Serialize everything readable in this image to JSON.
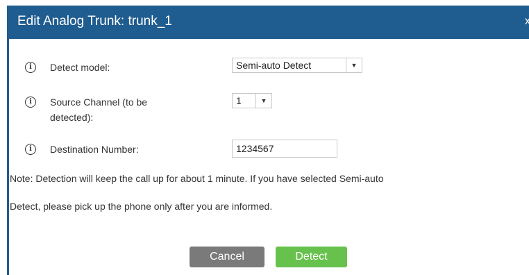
{
  "dialog": {
    "title": "Edit Analog Trunk: trunk_1",
    "close_label": "x"
  },
  "fields": {
    "detect_model": {
      "label": "Detect model:",
      "value": "Semi-auto Detect",
      "icon": "info-icon"
    },
    "source_channel": {
      "label_line1": "Source Channel (to be",
      "label_line2": "detected):",
      "value": "1",
      "icon": "info-icon"
    },
    "destination_number": {
      "label": "Destination Number:",
      "value": "1234567",
      "icon": "info-icon"
    }
  },
  "note": {
    "line1": "Note: Detection will keep the call up for about 1 minute. If you have selected Semi-auto",
    "line2": "Detect, please pick up the phone only after you are informed."
  },
  "buttons": {
    "cancel": "Cancel",
    "detect": "Detect"
  },
  "colors": {
    "title_bar": "#1f5c8f",
    "cancel_button": "#7a7a7a",
    "detect_button": "#67c24d"
  }
}
